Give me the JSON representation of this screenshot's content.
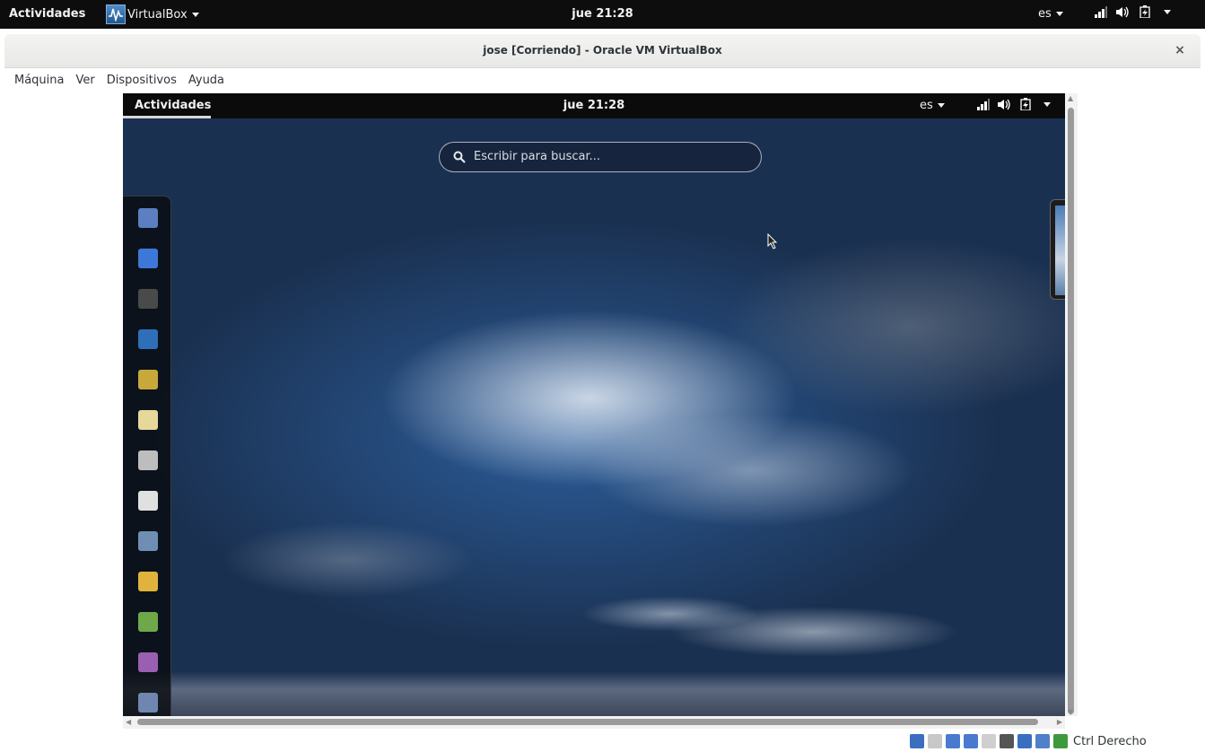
{
  "host_topbar": {
    "activities": "Actividades",
    "app_menu": "VirtualBox",
    "clock": "jue 21:28",
    "language": "es"
  },
  "window": {
    "title": "jose [Corriendo] - Oracle VM VirtualBox",
    "close_glyph": "×"
  },
  "menu": {
    "items": [
      "Máquina",
      "Ver",
      "Dispositivos",
      "Ayuda"
    ]
  },
  "guest": {
    "topbar": {
      "activities": "Actividades",
      "clock": "jue 21:28",
      "language": "es"
    },
    "search": {
      "placeholder": "Escribir para buscar..."
    },
    "dash_apps": [
      {
        "icon": "web-browser-icon",
        "color": "#5b7fc0"
      },
      {
        "icon": "chat-icon",
        "color": "#3c78d8"
      },
      {
        "icon": "terminal-icon",
        "color": "#4a4a4a"
      },
      {
        "icon": "document-icon",
        "color": "#2f6fb8"
      },
      {
        "icon": "sound-juicer-icon",
        "color": "#c8a83a"
      },
      {
        "icon": "text-editor-icon",
        "color": "#e6d79a"
      },
      {
        "icon": "calculator-icon",
        "color": "#bdbdbd"
      },
      {
        "icon": "tools-icon",
        "color": "#e0e0e0"
      },
      {
        "icon": "database-icon",
        "color": "#6e8fb3"
      },
      {
        "icon": "teapot-icon",
        "color": "#e0b43c"
      },
      {
        "icon": "ide-icon",
        "color": "#6ea84a"
      },
      {
        "icon": "video-editor-icon",
        "color": "#9a5fb0"
      },
      {
        "icon": "help-icon",
        "color": "#6f86b0"
      }
    ]
  },
  "statusbar": {
    "host_key": "Ctrl Derecho",
    "icons": [
      {
        "icon": "hard-disk-icon",
        "color": "#3a6fc0"
      },
      {
        "icon": "optical-drive-icon",
        "color": "#c8c8c8"
      },
      {
        "icon": "audio-icon",
        "color": "#4a7ad0"
      },
      {
        "icon": "network-icon",
        "color": "#4a7ad0"
      },
      {
        "icon": "usb-icon",
        "color": "#cfcfcf"
      },
      {
        "icon": "shared-folders-icon",
        "color": "#555555"
      },
      {
        "icon": "display-icon",
        "color": "#3a6fc0"
      },
      {
        "icon": "capture-icon",
        "color": "#5080c8"
      },
      {
        "icon": "host-key-icon",
        "color": "#3c9a3c"
      }
    ]
  }
}
